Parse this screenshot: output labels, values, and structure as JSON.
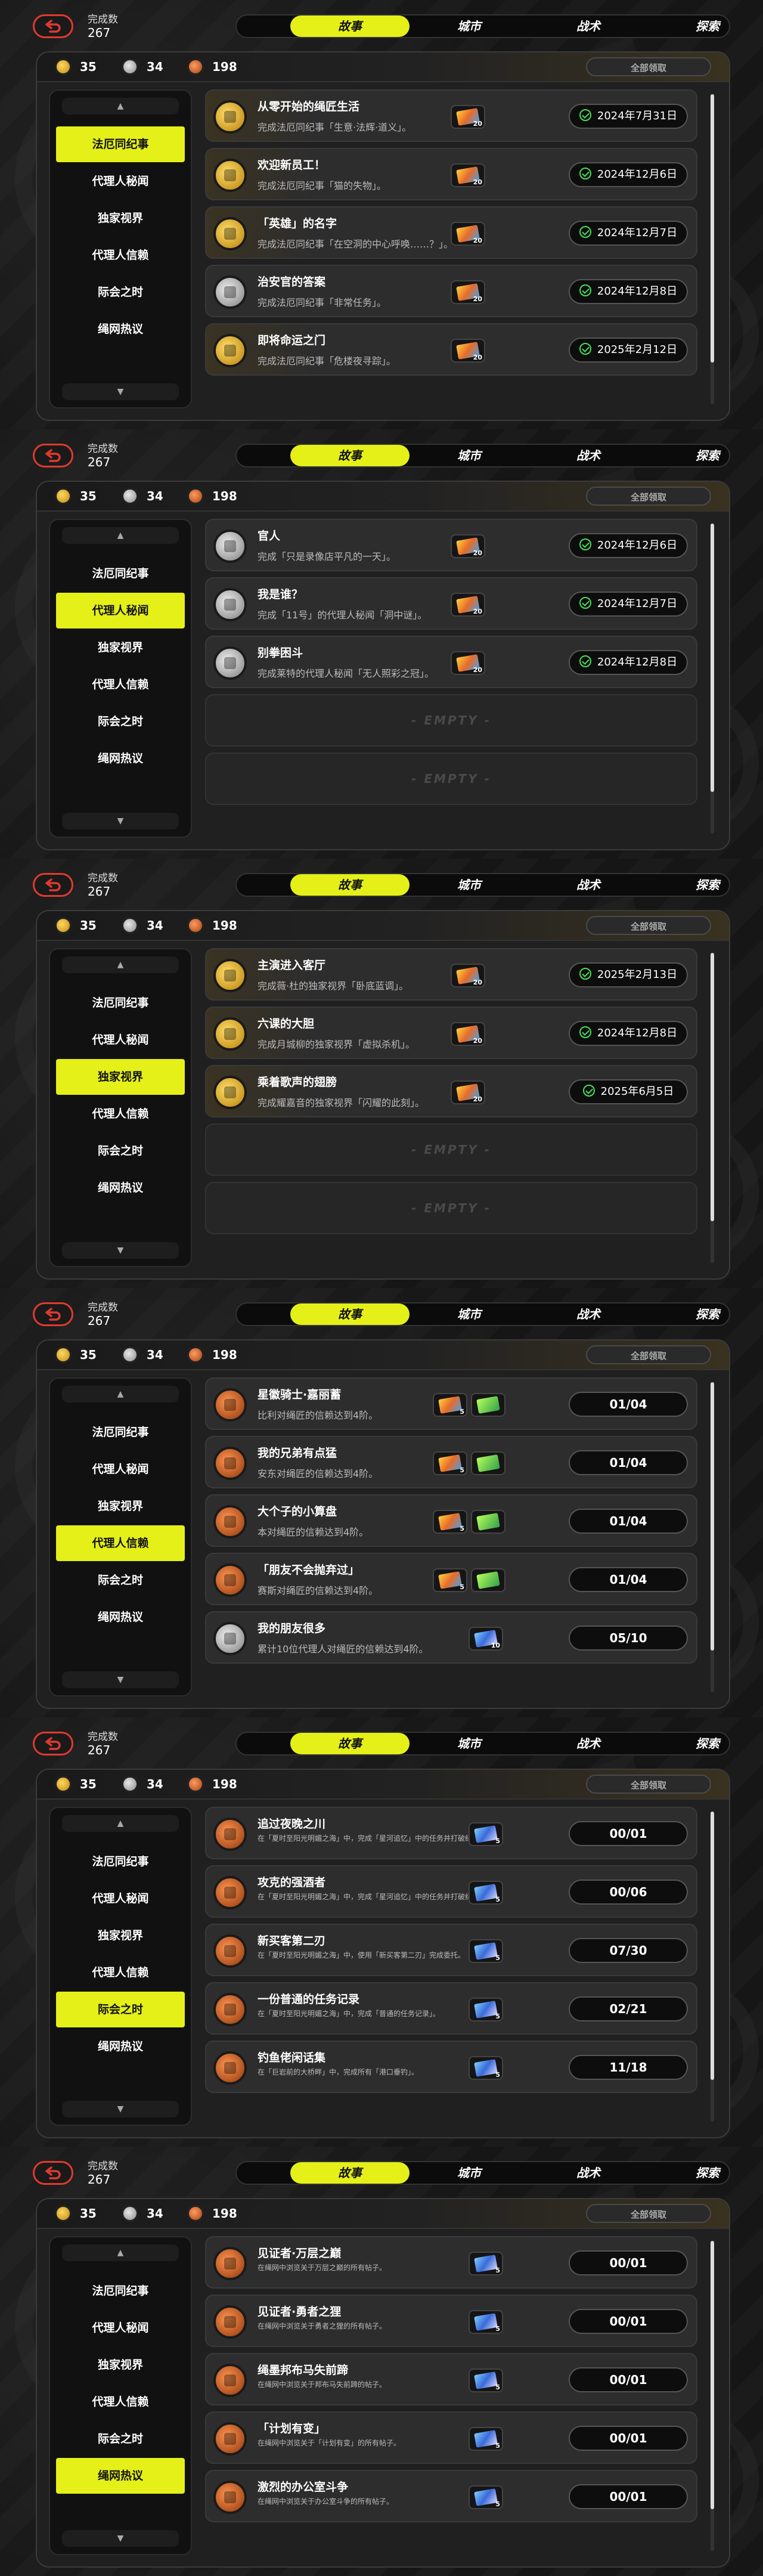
{
  "completion": {
    "label": "完成数",
    "count": "267"
  },
  "tabs": [
    "故事",
    "城市",
    "战术",
    "探索"
  ],
  "currency": {
    "gold": "35",
    "silver": "34",
    "bronze": "198"
  },
  "claim_all_label": "全部领取",
  "sidebar_items": [
    "法厄同纪事",
    "代理人秘闻",
    "独家视界",
    "代理人信赖",
    "际会之时",
    "绳网热议"
  ],
  "empty_label": "- EMPTY -",
  "sections": [
    {
      "active_tab": 0,
      "active_side": 0,
      "cards": [
        {
          "medal": "gold",
          "title": "从零开始的绳匠生活",
          "desc": "完成法厄同纪事「生意·法辉·道义」。",
          "reward": "gold",
          "reward_qty": "20",
          "status_type": "date",
          "status": "2024年7月31日"
        },
        {
          "medal": "gold",
          "title": "欢迎新员工！",
          "desc": "完成法厄同纪事「猫的失物」。",
          "reward": "gold",
          "reward_qty": "20",
          "status_type": "date",
          "status": "2024年12月6日"
        },
        {
          "medal": "gold",
          "title": "「英雄」的名字",
          "desc": "完成法厄同纪事「在空洞的中心呼唤……？」。",
          "reward": "gold",
          "reward_qty": "20",
          "status_type": "date",
          "status": "2024年12月7日"
        },
        {
          "medal": "silver",
          "title": "治安官的答案",
          "desc": "完成法厄同纪事「非常任务」。",
          "reward": "gold",
          "reward_qty": "20",
          "status_type": "date",
          "status": "2024年12月8日"
        },
        {
          "medal": "gold",
          "title": "即将命运之门",
          "desc": "完成法厄同纪事「危楼夜寻踪」。",
          "reward": "gold",
          "reward_qty": "20",
          "status_type": "date",
          "status": "2025年2月12日"
        }
      ],
      "empty_count": 0
    },
    {
      "active_tab": 0,
      "active_side": 1,
      "cards": [
        {
          "medal": "silver",
          "title": "官人",
          "desc": "完成「只是录像店平凡的一天」。",
          "reward": "gold",
          "reward_qty": "20",
          "status_type": "date",
          "status": "2024年12月6日"
        },
        {
          "medal": "silver",
          "title": "我是谁？",
          "desc": "完成「11号」的代理人秘闻「洞中谜」。",
          "reward": "gold",
          "reward_qty": "20",
          "status_type": "date",
          "status": "2024年12月7日"
        },
        {
          "medal": "silver",
          "title": "别拳困斗",
          "desc": "完成莱特的代理人秘闻「无人照彩之冠」。",
          "reward": "gold",
          "reward_qty": "20",
          "status_type": "date",
          "status": "2024年12月8日"
        }
      ],
      "empty_count": 2
    },
    {
      "active_tab": 0,
      "active_side": 2,
      "cards": [
        {
          "medal": "gold",
          "title": "主演进入客厅",
          "desc": "完成薇·杜的独家视界「卧底蓝调」。",
          "reward": "gold",
          "reward_qty": "20",
          "status_type": "date",
          "status": "2025年2月13日"
        },
        {
          "medal": "gold",
          "title": "六课的大胆",
          "desc": "完成月城柳的独家视界「虚拟杀机」。",
          "reward": "gold",
          "reward_qty": "20",
          "status_type": "date",
          "status": "2024年12月8日"
        },
        {
          "medal": "gold",
          "title": "乘着歌声的翅膀",
          "desc": "完成耀嘉音的独家视界「闪耀的此刻」。",
          "reward": "gold",
          "reward_qty": "20",
          "status_type": "date",
          "status": "2025年6月5日"
        }
      ],
      "empty_count": 2
    },
    {
      "active_tab": 0,
      "active_side": 3,
      "cards": [
        {
          "medal": "bronze",
          "title": "星徽骑士·嘉丽蓄",
          "desc": "比利对绳匠的信赖达到4阶。",
          "reward": "gold",
          "reward_qty": "5",
          "extra_reward": true,
          "status_type": "progress",
          "status": "01/04"
        },
        {
          "medal": "bronze",
          "title": "我的兄弟有点猛",
          "desc": "安东对绳匠的信赖达到4阶。",
          "reward": "gold",
          "reward_qty": "5",
          "extra_reward": true,
          "status_type": "progress",
          "status": "01/04"
        },
        {
          "medal": "bronze",
          "title": "大个子的小算盘",
          "desc": "本对绳匠的信赖达到4阶。",
          "reward": "gold",
          "reward_qty": "5",
          "extra_reward": true,
          "status_type": "progress",
          "status": "01/04"
        },
        {
          "medal": "bronze",
          "title": "「朋友不会抛弃过」",
          "desc": "赛斯对绳匠的信赖达到4阶。",
          "reward": "gold",
          "reward_qty": "5",
          "extra_reward": true,
          "status_type": "progress",
          "status": "01/04"
        },
        {
          "medal": "silver",
          "title": "我的朋友很多",
          "desc": "累计10位代理人对绳匠的信赖达到4阶。",
          "reward": "blue",
          "reward_qty": "10",
          "status_type": "progress",
          "status": "05/10"
        }
      ],
      "empty_count": 0
    },
    {
      "active_tab": 0,
      "active_side": 4,
      "cards": [
        {
          "medal": "bronze",
          "title": "追过夜晚之川",
          "desc": "在「夏时至阳光明媚之海」中，完成「星河追忆」中的任务并打破纪录。",
          "reward": "blue",
          "reward_qty": "5",
          "status_type": "progress",
          "status": "00/01",
          "small": true
        },
        {
          "medal": "bronze",
          "title": "攻克的强酒者",
          "desc": "在「夏时至阳光明媚之海」中，完成「星河追忆」中的任务并打破纪录。",
          "reward": "blue",
          "reward_qty": "5",
          "status_type": "progress",
          "status": "00/06",
          "small": true
        },
        {
          "medal": "bronze",
          "title": "新买客第二刃",
          "desc": "在「夏时至阳光明媚之海」中，使用「新买客第二刃」完成委托。",
          "reward": "blue",
          "reward_qty": "5",
          "status_type": "progress",
          "status": "07/30",
          "small": true
        },
        {
          "medal": "bronze",
          "title": "一份普通的任务记录",
          "desc": "在「夏时至阳光明媚之海」中，完成「普通的任务记录」。",
          "reward": "blue",
          "reward_qty": "5",
          "status_type": "progress",
          "status": "02/21",
          "small": true
        },
        {
          "medal": "bronze",
          "title": "钓鱼佬闲话集",
          "desc": "在「巨岩前的大桥畔」中，完成所有「港口垂钓」。",
          "reward": "blue",
          "reward_qty": "5",
          "status_type": "progress",
          "status": "11/18",
          "small": true
        }
      ],
      "empty_count": 0
    },
    {
      "active_tab": 0,
      "active_side": 5,
      "cards": [
        {
          "medal": "bronze",
          "title": "见证者·万层之巅",
          "desc": "在绳网中浏览关于万层之巅的所有帖子。",
          "reward": "blue",
          "reward_qty": "5",
          "status_type": "progress",
          "status": "00/01",
          "small": true
        },
        {
          "medal": "bronze",
          "title": "见证者·勇者之狸",
          "desc": "在绳网中浏览关于勇者之狸的所有帖子。",
          "reward": "blue",
          "reward_qty": "5",
          "status_type": "progress",
          "status": "00/01",
          "small": true
        },
        {
          "medal": "bronze",
          "title": "绳墨邦布马失前蹄",
          "desc": "在绳网中浏览关于邦布马失前蹄的帖子。",
          "reward": "blue",
          "reward_qty": "5",
          "status_type": "progress",
          "status": "00/01",
          "small": true
        },
        {
          "medal": "bronze",
          "title": "「计划有变」",
          "desc": "在绳网中浏览关于「计划有变」的所有帖子。",
          "reward": "blue",
          "reward_qty": "5",
          "status_type": "progress",
          "status": "00/01",
          "small": true
        },
        {
          "medal": "bronze",
          "title": "激烈的办公室斗争",
          "desc": "在绳网中浏览关于办公室斗争的所有帖子。",
          "reward": "blue",
          "reward_qty": "5",
          "status_type": "progress",
          "status": "00/01",
          "small": true
        }
      ],
      "empty_count": 0
    }
  ]
}
